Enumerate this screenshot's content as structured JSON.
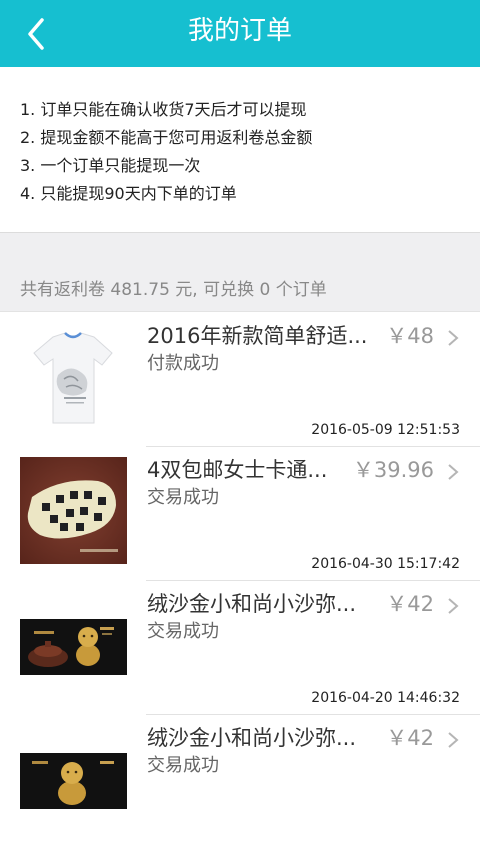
{
  "header": {
    "title": "我的订单",
    "back_icon": "chevron-left-icon",
    "color": "#16bfd0"
  },
  "rules": [
    "1. 订单只能在确认收货7天后才可以提现",
    "2. 提现金额不能高于您可用返利卷总金额",
    "3. 一个订单只能提现一次",
    "4. 只能提现90天内下单的订单"
  ],
  "summary": "共有返利卷 481.75 元, 可兑换 0 个订单",
  "orders": [
    {
      "name": "2016年新款简单舒适...",
      "price": "￥48",
      "status": "付款成功",
      "date": "2016-05-09 12:51:53",
      "thumb": "white-tshirt"
    },
    {
      "name": "4双包邮女士卡通...",
      "price": "￥39.96",
      "status": "交易成功",
      "date": "2016-04-30 15:17:42",
      "thumb": "socks"
    },
    {
      "name": "绒沙金小和尚小沙弥...",
      "price": "￥42",
      "status": "交易成功",
      "date": "2016-04-20 14:46:32",
      "thumb": "monk-figurine"
    },
    {
      "name": "绒沙金小和尚小沙弥...",
      "price": "￥42",
      "status": "交易成功",
      "date": "",
      "thumb": "monk-figurine"
    }
  ]
}
